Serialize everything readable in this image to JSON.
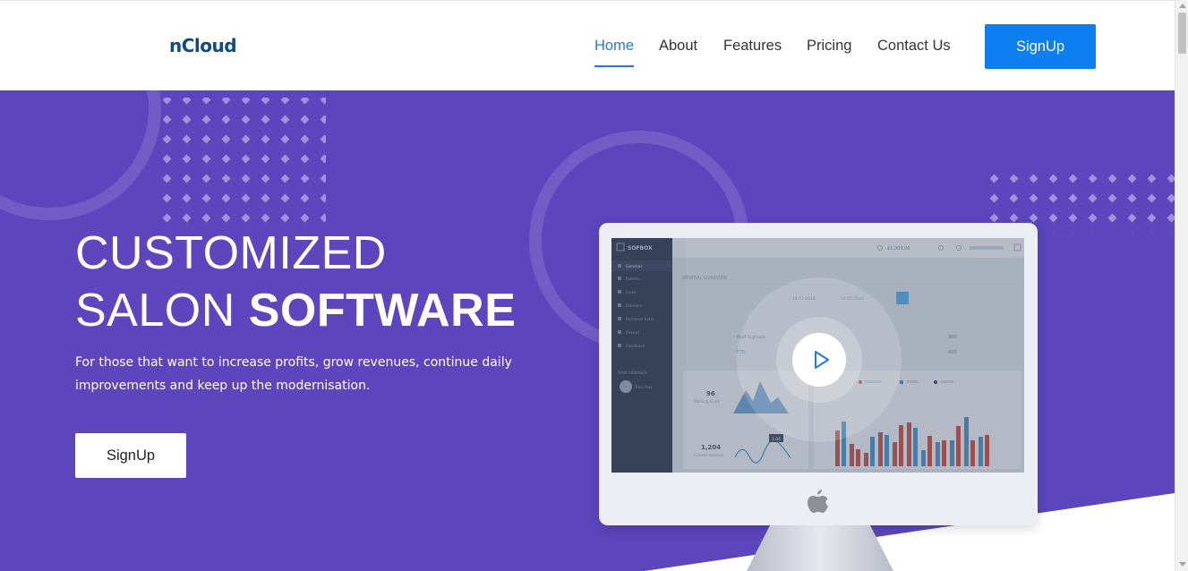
{
  "header": {
    "logo": "nCloud",
    "nav": [
      {
        "label": "Home",
        "active": true
      },
      {
        "label": "About",
        "active": false
      },
      {
        "label": "Features",
        "active": false
      },
      {
        "label": "Pricing",
        "active": false
      },
      {
        "label": "Contact Us",
        "active": false
      }
    ],
    "signup_label": "SignUp"
  },
  "hero": {
    "headline_line1": "CUSTOMIZED",
    "headline_line2_regular": "SALON ",
    "headline_line2_bold": "SOFTWARE",
    "subtext": "For those that want to increase profits, grow revenues, continue daily improvements and keep up the modernisation.",
    "signup_label": "SignUp"
  },
  "dashboard": {
    "brand": "SOFBOX",
    "balance": "$1,000.00",
    "section_title": "GENERAL OVERVIEW",
    "menu": [
      "General",
      "Details",
      "Links",
      "Banners",
      "Personal data",
      "Payout",
      "Feedback"
    ],
    "manager_heading": "YOUR MANAGER",
    "manager_name": "Tom Yoki",
    "date_from": "14.07.2016",
    "date_to": "14.07.2016",
    "stat1_value": "96",
    "stat1_label": "Working hours",
    "stat2_value": "1,204",
    "stat2_label": "Current sessions",
    "row1_label": "Paid Signups",
    "row1_value": "900",
    "row2_label": "FTD",
    "row2_value": "400",
    "tag_value": "1,04"
  },
  "colors": {
    "hero_bg": "#5c45bd",
    "accent": "#0d7ff0",
    "nav_active": "#1f7dd8",
    "logo": "#0e4a86"
  }
}
